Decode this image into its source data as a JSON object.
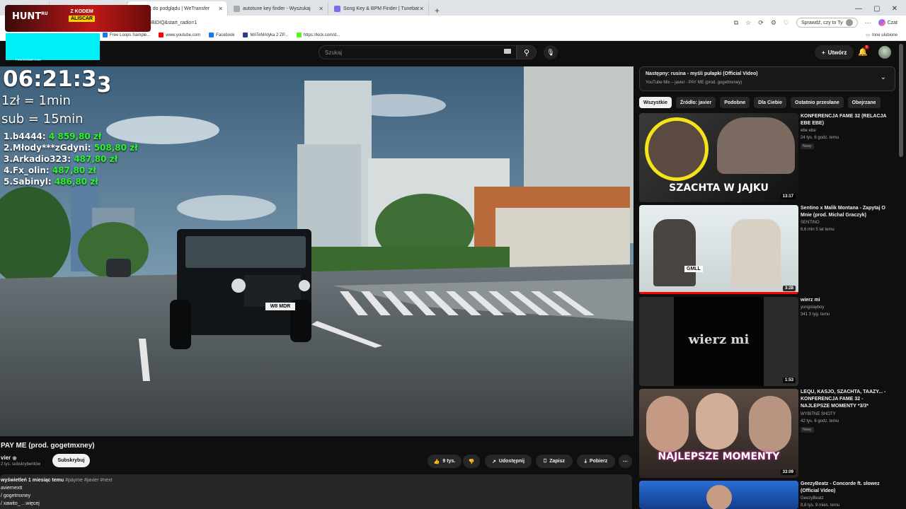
{
  "browser": {
    "tabs": [
      {
        "label": ""
      },
      {
        "label": "Link do podglądu | WeTransfer"
      },
      {
        "label": "autotune key finder - Wyszukaj"
      },
      {
        "label": "Song Key & BPM Finder | Tunebat"
      }
    ],
    "new_tab": "+",
    "url": "eBiDIQ&start_radio=1",
    "copilot_search": "Sprawdź, czy to Ty",
    "chat_label": "Czat",
    "bookmarks": [
      "Free Loops Sample...",
      "www.youtube.com",
      "Facebook",
      "MATeMAtyka 2 ZP...",
      "https://kick.com/d..."
    ],
    "other_bookmarks": "Inne ulubione"
  },
  "overlay": {
    "hunt_logo": "HUNT",
    "hunt_logo_sup": "RU",
    "code_line1": "Z KODEM",
    "code_line2": "ALISCAR",
    "cyan_caption": "PIRATESWAP.COM",
    "timer_main": "06:21:3",
    "timer_sub": "3",
    "rate_line1": "1zł = 1min",
    "rate_line2": "sub = 15min",
    "leaderboard": [
      {
        "name": "1.b4444:",
        "amount": "4 859,80 zł"
      },
      {
        "name": "2.Młody***zGdyni:",
        "amount": "508,80 zł"
      },
      {
        "name": "3.Arkadio323:",
        "amount": "487,80 zł"
      },
      {
        "name": "4.Fx_olin:",
        "amount": "487,80 zł"
      },
      {
        "name": "5.Sabinyl:",
        "amount": "486,80 zł"
      }
    ],
    "plate": "W8 MDR"
  },
  "youtube": {
    "search_placeholder": "Szukaj",
    "create_label": "Utwórz",
    "notif_count": "9",
    "video_title": "PAY ME (prod. gogetmxney)",
    "channel": "vier",
    "subscribers": "2 tys. subskrybentów",
    "subscribe_label": "Subskrybuj",
    "likes": "9 tys.",
    "share_label": "Udostępnij",
    "save_label": "Zapisz",
    "download_label": "Pobierz",
    "description_meta": "wyświetleń  1 miesiąc temu",
    "description_tags": "#payme #javier #next",
    "description_lines": [
      "aviernextt",
      "/ gogetmxney",
      "/ xawito_   ...więcej"
    ]
  },
  "sidebar": {
    "up_next_title": "Następny: rusina - myśli pułapki (Official Video)",
    "up_next_sub": "YouTube Mix – javier - PAY ME (prod. gogetmxney)",
    "chips": [
      "Wszystkie",
      "Źródło: javier",
      "Podobne",
      "Dla Ciebie",
      "Ostatnio przesłane",
      "Obejrzane"
    ],
    "recommendations": [
      {
        "title": "KONFERENCJA FAME 32 (RELACJA EBE EBE)",
        "channel": "ebe ebe",
        "stats": "24 tys.  6 godz. temu",
        "badge": "Nowy",
        "duration": "13:17",
        "thumb_text": "SZACHTA W JAJKU"
      },
      {
        "title": "Sentino x Malik Montana - Zapytaj O Mnie (prod. Michal Graczyk)",
        "channel": "SENTINO",
        "stats": "6,6 mln  5 lat temu",
        "badge": "",
        "duration": "3:28",
        "thumb_text": "GMLL"
      },
      {
        "title": "wierz mi",
        "channel": "yungslayboy",
        "stats": "341  3 tyg. temu",
        "badge": "",
        "duration": "1:53",
        "thumb_text": "wierz mi"
      },
      {
        "title": "LEQU, KASJO, SZACHTA, TAAZY... - KONFERENCJA FAME 32 - NAJLEPSZE MOMENTY *3/3*",
        "channel": "WYBITNE SHOTY",
        "stats": "42 tys.  6 godz. temu",
        "badge": "Nowy",
        "duration": "33:09",
        "thumb_text": "NAJLEPSZE MOMENTY"
      },
      {
        "title": "GeezyBeatz - Concorde ft. slowez (Official Video)",
        "channel": "GeezyBeatz",
        "stats": "8,8 tys.  9 mies. temu",
        "badge": "",
        "duration": "",
        "thumb_text": ""
      }
    ]
  },
  "colors": {
    "yt_bg": "#0f0f0f",
    "chip_bg": "#272727",
    "donation_green": "#2cf52c",
    "hunt_red": "#c01818",
    "cyan": "#00eef5"
  }
}
